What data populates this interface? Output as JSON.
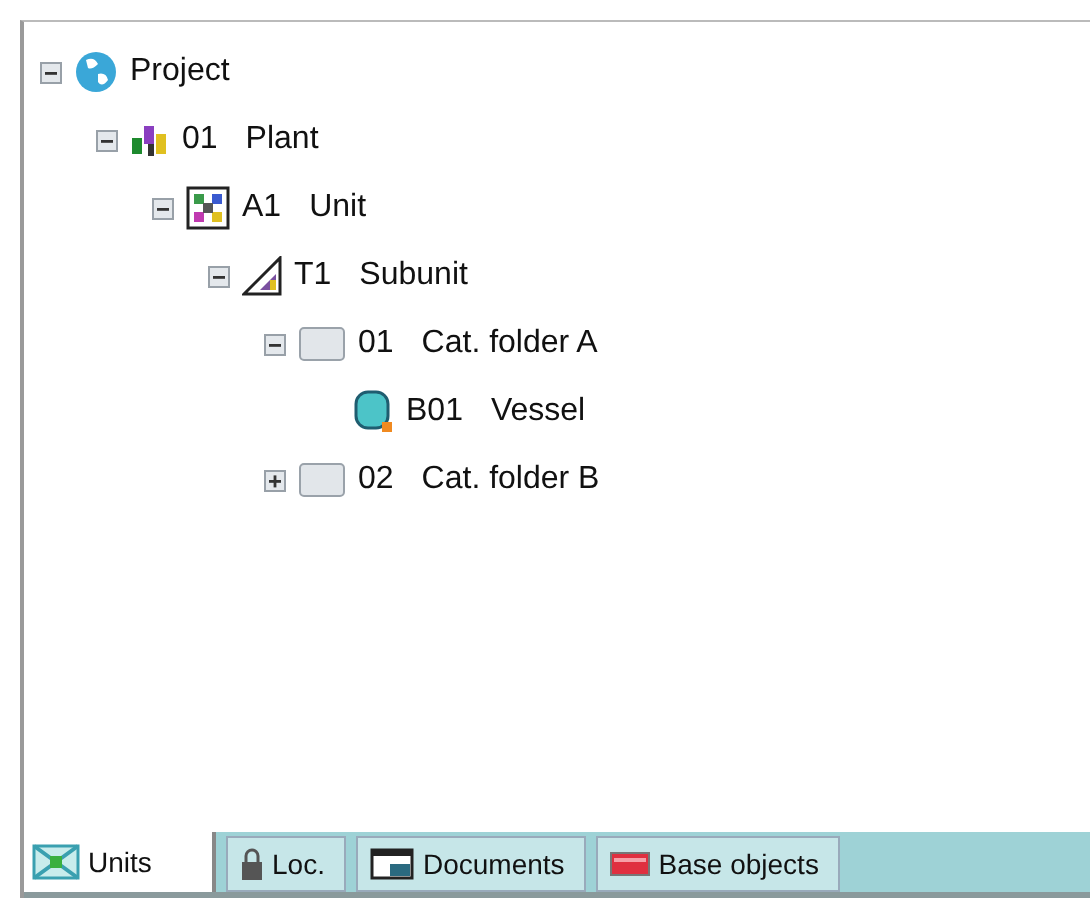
{
  "tree": [
    {
      "kind": "project",
      "code": "Project",
      "expanded": true,
      "children": [
        {
          "kind": "plant",
          "code": "01",
          "name": "Plant",
          "expanded": true,
          "children": [
            {
              "kind": "unit",
              "code": "A1",
              "name": "Unit",
              "expanded": true,
              "children": [
                {
                  "kind": "subunit",
                  "code": "T1",
                  "name": "Subunit",
                  "expanded": true,
                  "children": [
                    {
                      "kind": "folder",
                      "code": "01",
                      "name": "Cat. folder A",
                      "expanded": true,
                      "children": [
                        {
                          "kind": "vessel",
                          "code": "B01",
                          "name": "Vessel"
                        }
                      ]
                    },
                    {
                      "kind": "folder",
                      "code": "02",
                      "name": "Cat. folder B",
                      "expanded": false
                    }
                  ]
                }
              ]
            }
          ]
        }
      ]
    }
  ],
  "tabs": [
    {
      "kind": "units",
      "label": "Units",
      "selected": true
    },
    {
      "kind": "loc",
      "label": "Loc.",
      "selected": false
    },
    {
      "kind": "documents",
      "label": "Documents",
      "selected": false
    },
    {
      "kind": "base",
      "label": "Base objects",
      "selected": false
    }
  ]
}
